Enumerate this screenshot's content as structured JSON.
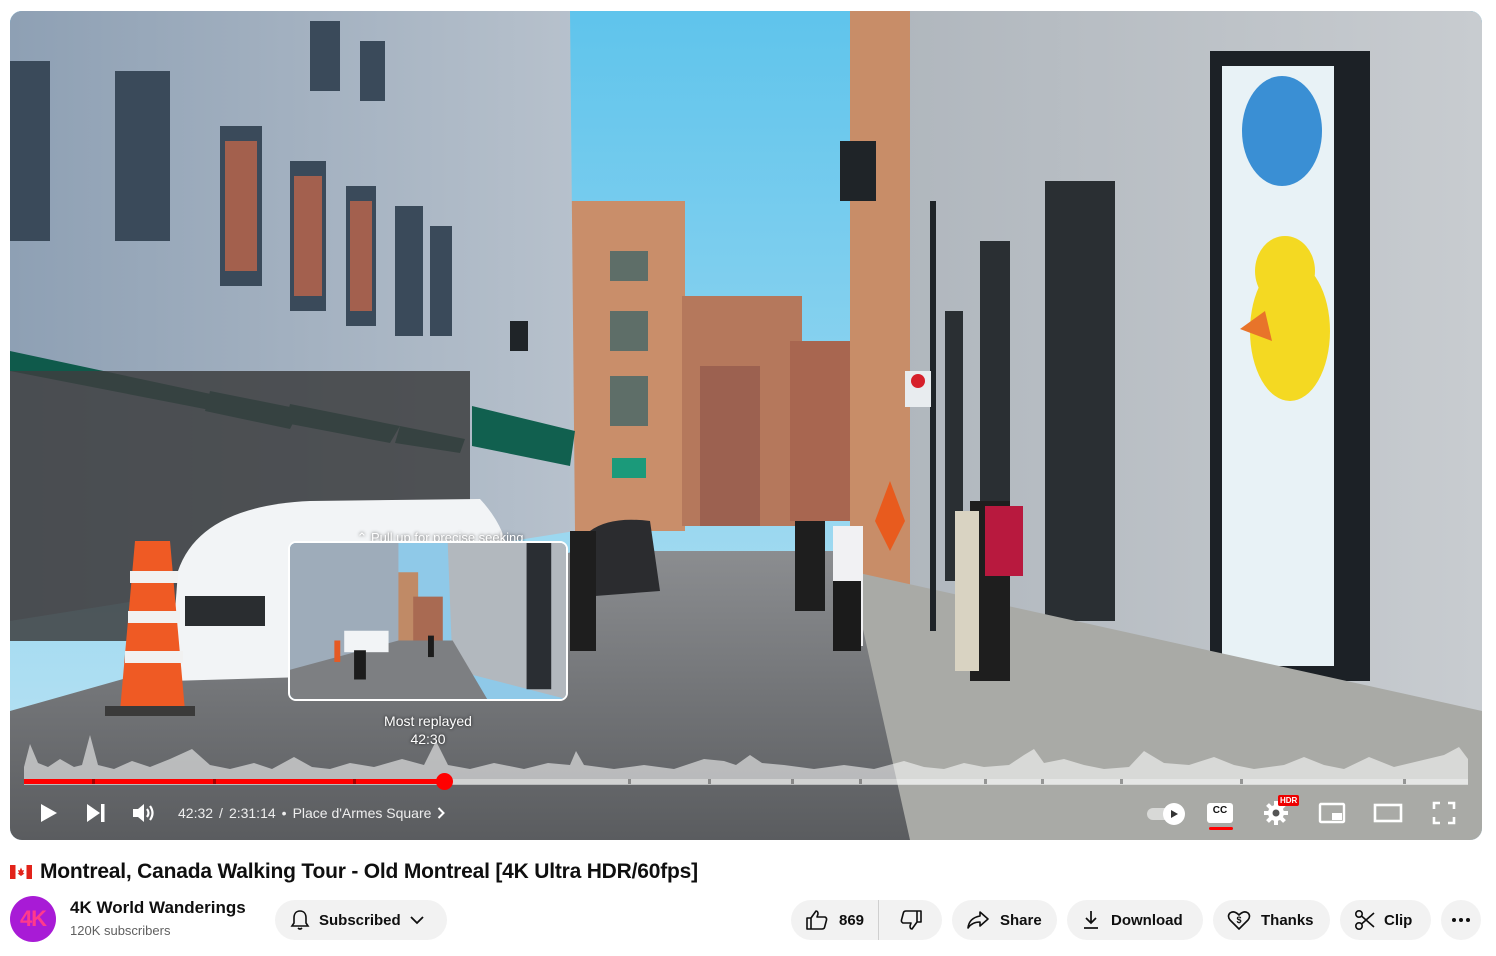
{
  "player": {
    "preview_hint": "Pull up for precise seeking",
    "preview_label": "Most replayed",
    "preview_time": "42:30",
    "progress_fraction": 0.291,
    "current_time": "42:32",
    "time_separator": "/",
    "duration": "2:31:14",
    "chapter_separator": "•",
    "chapter_title": "Place d'Armes Square",
    "chapter_marks": [
      0.047,
      0.131,
      0.228,
      0.287,
      0.418,
      0.474,
      0.531,
      0.578,
      0.665,
      0.704,
      0.759,
      0.842,
      0.955
    ],
    "cc_label": "CC",
    "hdr_badge": "HDR",
    "accent_color": "#ff0000",
    "icons": [
      "play-icon",
      "next-icon",
      "volume-icon",
      "chevron-right-icon",
      "autoplay-icon",
      "cc-icon",
      "settings-icon",
      "miniplayer-icon",
      "theater-icon",
      "fullscreen-icon"
    ]
  },
  "video": {
    "flag": "canada-flag",
    "title": "Montreal, Canada Walking Tour - Old Montreal [4K Ultra HDR/60fps]"
  },
  "channel": {
    "avatar_text": "4K",
    "name": "4K World Wanderings",
    "subscribers": "120K subscribers",
    "subscribe_label": "Subscribed"
  },
  "actions": {
    "like_count": "869",
    "share_label": "Share",
    "download_label": "Download",
    "thanks_label": "Thanks",
    "clip_label": "Clip"
  }
}
